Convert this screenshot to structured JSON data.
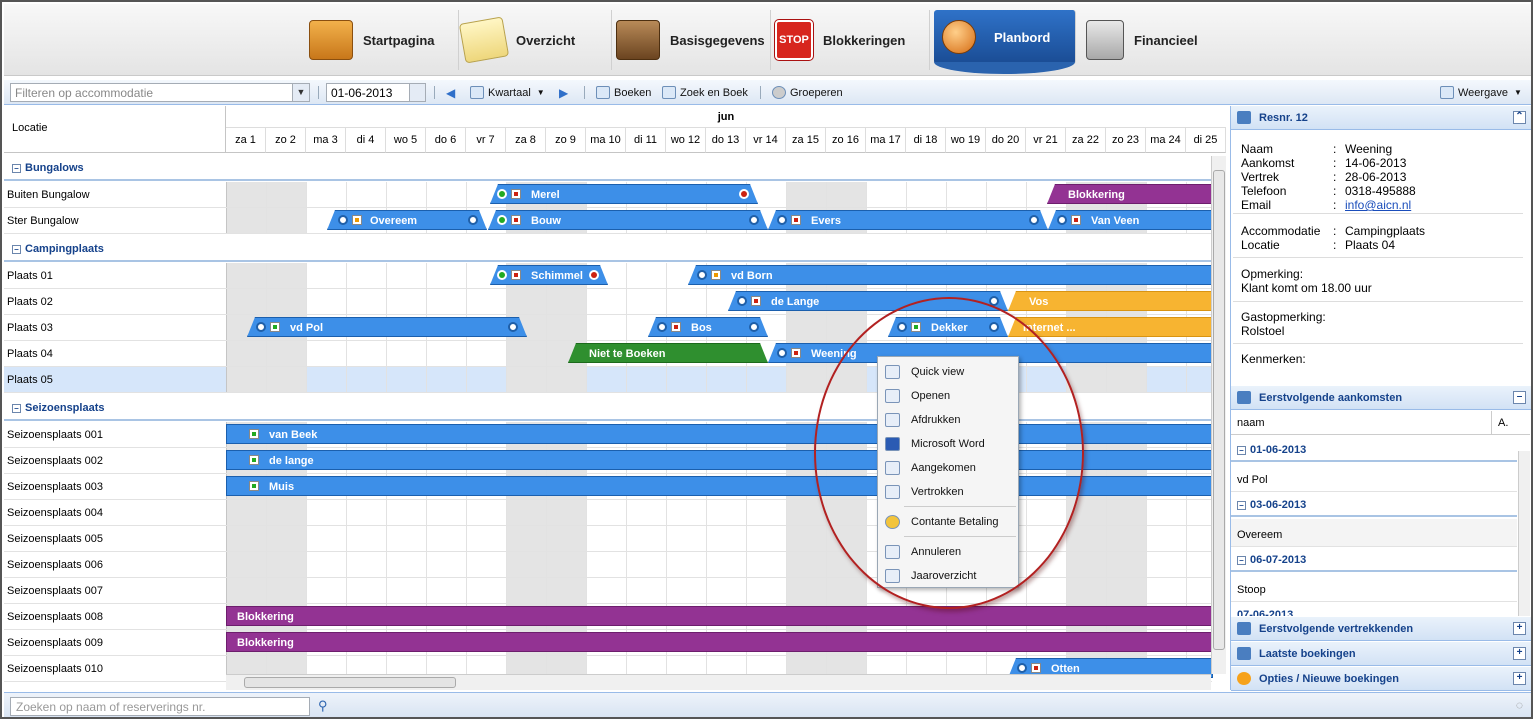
{
  "nav": {
    "tabs": [
      {
        "label": "Startpagina",
        "icon": "folder-icon"
      },
      {
        "label": "Overzicht",
        "icon": "notepad-icon"
      },
      {
        "label": "Basisgegevens",
        "icon": "wallet-icon"
      },
      {
        "label": "Blokkeringen",
        "icon": "stop-sign-icon"
      },
      {
        "label": "Planbord",
        "icon": "pin-icon",
        "active": true
      },
      {
        "label": "Financieel",
        "icon": "cash-register-icon"
      }
    ]
  },
  "toolbar": {
    "filter_placeholder": "Filteren op accommodatie",
    "date": "01-06-2013",
    "period": "Kwartaal",
    "book": "Boeken",
    "search_book": "Zoek en Boek",
    "group": "Groeperen",
    "view": "Weergave"
  },
  "grid": {
    "location_header": "Locatie",
    "month": "jun",
    "days": [
      "za 1",
      "zo 2",
      "ma 3",
      "di 4",
      "wo 5",
      "do 6",
      "vr 7",
      "za 8",
      "zo 9",
      "ma 10",
      "di 11",
      "wo 12",
      "do 13",
      "vr 14",
      "za 15",
      "zo 16",
      "ma 17",
      "di 18",
      "wo 19",
      "do 20",
      "vr 21",
      "za 22",
      "zo 23",
      "ma 24",
      "di 25"
    ],
    "groups": {
      "bungalows": "Bungalows",
      "campingplaats": "Campingplaats",
      "seizoensplaats": "Seizoensplaats"
    },
    "rows": {
      "buiten_bungalow": "Buiten Bungalow",
      "ster_bungalow": "Ster Bungalow",
      "plaats01": "Plaats 01",
      "plaats02": "Plaats 02",
      "plaats03": "Plaats 03",
      "plaats04": "Plaats 04",
      "plaats05": "Plaats 05",
      "s001": "Seizoensplaats 001",
      "s002": "Seizoensplaats 002",
      "s003": "Seizoensplaats 003",
      "s004": "Seizoensplaats 004",
      "s005": "Seizoensplaats 005",
      "s006": "Seizoensplaats 006",
      "s007": "Seizoensplaats 007",
      "s008": "Seizoensplaats 008",
      "s009": "Seizoensplaats 009",
      "s010": "Seizoensplaats 010"
    },
    "bookings": {
      "merel": "Merel",
      "blokkering": "Blokkering",
      "overeem": "Overeem",
      "bouw": "Bouw",
      "evers": "Evers",
      "vanveen": "Van Veen",
      "schimmel": "Schimmel",
      "vdborn": "vd Born",
      "delange": "de Lange",
      "vos": "Vos",
      "vdpol": "vd Pol",
      "bos": "Bos",
      "dekker": "Dekker",
      "internet": "Internet ...",
      "nietteboeken": "Niet te Boeken",
      "weening": "Weening",
      "vanbeek": "van Beek",
      "delange2": "de lange",
      "muis": "Muis",
      "otten": "Otten"
    }
  },
  "context_menu": {
    "items": [
      "Quick view",
      "Openen",
      "Afdrukken",
      "Microsoft Word",
      "Aangekomen",
      "Vertrokken",
      "Contante Betaling",
      "Annuleren",
      "Jaaroverzicht"
    ]
  },
  "detail": {
    "title": "Resnr. 12",
    "naam_k": "Naam",
    "naam_v": "Weening",
    "aankomst_k": "Aankomst",
    "aankomst_v": "14-06-2013",
    "vertrek_k": "Vertrek",
    "vertrek_v": "28-06-2013",
    "telefoon_k": "Telefoon",
    "telefoon_v": "0318-495888",
    "email_k": "Email",
    "email_v": "info@aicn.nl",
    "accommodatie_k": "Accommodatie",
    "accommodatie_v": "Campingplaats",
    "locatie_k": "Locatie",
    "locatie_v": "Plaats 04",
    "opmerking_k": "Opmerking:",
    "opmerking_v": "Klant komt om 18.00 uur",
    "gastopmerking_k": "Gastopmerking:",
    "gastopmerking_v": "Rolstoel",
    "kenmerken_k": "Kenmerken:",
    "colon": ":"
  },
  "arrivals": {
    "title": "Eerstvolgende aankomsten",
    "col_name": "naam",
    "col_a": "A.",
    "g1": "01-06-2013",
    "r1": "vd Pol",
    "g2": "03-06-2013",
    "r2": "Overeem",
    "g3": "06-07-2013",
    "r3": "Stoop",
    "g4": "07-06-2013"
  },
  "panels": {
    "departures": "Eerstvolgende vertrekkenden",
    "latest": "Laatste boekingen",
    "options": "Opties / Nieuwe boekingen"
  },
  "footer": {
    "search_placeholder": "Zoeken op naam of reserverings nr."
  },
  "colors": {
    "booking_blue": "#3d8fe8",
    "blocked_purple": "#933393",
    "pending_orange": "#f7b431",
    "not_bookable_green": "#2f8f2f",
    "header_blue": "#15428b"
  }
}
